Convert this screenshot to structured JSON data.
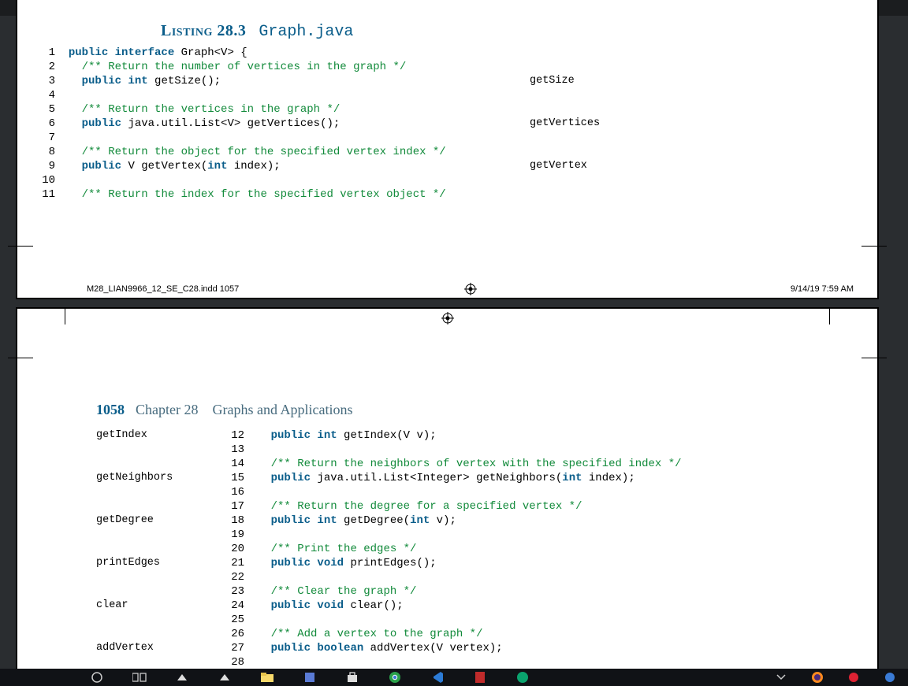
{
  "page1": {
    "listing_label": "Listing 28.3",
    "listing_file": "Graph.java",
    "annotations": [
      "",
      "",
      "getSize",
      "",
      "",
      "getVertices",
      "",
      "",
      "getVertex",
      "",
      ""
    ],
    "footer_left": "M28_LIAN9966_12_SE_C28.indd   1057",
    "footer_right": "9/14/19   7:59 AM",
    "code": [
      {
        "n": "1",
        "seg": [
          {
            "t": "public interface ",
            "c": "kw"
          },
          {
            "t": "Graph<V> {",
            "c": "id"
          }
        ]
      },
      {
        "n": "2",
        "seg": [
          {
            "t": "  ",
            "c": "id"
          },
          {
            "t": "/** Return the number of vertices in the graph */",
            "c": "cm"
          }
        ]
      },
      {
        "n": "3",
        "seg": [
          {
            "t": "  ",
            "c": "id"
          },
          {
            "t": "public int ",
            "c": "kw"
          },
          {
            "t": "getSize();",
            "c": "id"
          }
        ]
      },
      {
        "n": "4",
        "seg": []
      },
      {
        "n": "5",
        "seg": [
          {
            "t": "  ",
            "c": "id"
          },
          {
            "t": "/** Return the vertices in the graph */",
            "c": "cm"
          }
        ]
      },
      {
        "n": "6",
        "seg": [
          {
            "t": "  ",
            "c": "id"
          },
          {
            "t": "public ",
            "c": "kw"
          },
          {
            "t": "java.util.List<V> getVertices();",
            "c": "id"
          }
        ]
      },
      {
        "n": "7",
        "seg": []
      },
      {
        "n": "8",
        "seg": [
          {
            "t": "  ",
            "c": "id"
          },
          {
            "t": "/** Return the object for the specified vertex index */",
            "c": "cm"
          }
        ]
      },
      {
        "n": "9",
        "seg": [
          {
            "t": "  ",
            "c": "id"
          },
          {
            "t": "public ",
            "c": "kw"
          },
          {
            "t": "V getVertex(",
            "c": "id"
          },
          {
            "t": "int ",
            "c": "kw"
          },
          {
            "t": "index);",
            "c": "id"
          }
        ]
      },
      {
        "n": "10",
        "seg": []
      },
      {
        "n": "11",
        "seg": [
          {
            "t": "  ",
            "c": "id"
          },
          {
            "t": "/** Return the index for the specified vertex object */",
            "c": "cm"
          }
        ]
      }
    ]
  },
  "page2": {
    "page_num": "1058",
    "chapter": "Chapter 28",
    "chapter_title": "Graphs and Applications",
    "margin_notes": [
      "getIndex",
      "",
      "",
      "getNeighbors",
      "",
      "",
      "getDegree",
      "",
      "",
      "printEdges",
      "",
      "",
      "clear",
      "",
      "",
      "addVertex",
      "",
      ""
    ],
    "code": [
      {
        "n": "12",
        "seg": [
          {
            "t": "  ",
            "c": "id"
          },
          {
            "t": "public int ",
            "c": "kw"
          },
          {
            "t": "getIndex(V v);",
            "c": "id"
          }
        ]
      },
      {
        "n": "13",
        "seg": []
      },
      {
        "n": "14",
        "seg": [
          {
            "t": "  ",
            "c": "id"
          },
          {
            "t": "/** Return the neighbors of vertex with the specified index */",
            "c": "cm"
          }
        ]
      },
      {
        "n": "15",
        "seg": [
          {
            "t": "  ",
            "c": "id"
          },
          {
            "t": "public ",
            "c": "kw"
          },
          {
            "t": "java.util.List<Integer> getNeighbors(",
            "c": "id"
          },
          {
            "t": "int ",
            "c": "kw"
          },
          {
            "t": "index);",
            "c": "id"
          }
        ]
      },
      {
        "n": "16",
        "seg": []
      },
      {
        "n": "17",
        "seg": [
          {
            "t": "  ",
            "c": "id"
          },
          {
            "t": "/** Return the degree for a specified vertex */",
            "c": "cm"
          }
        ]
      },
      {
        "n": "18",
        "seg": [
          {
            "t": "  ",
            "c": "id"
          },
          {
            "t": "public int ",
            "c": "kw"
          },
          {
            "t": "getDegree(",
            "c": "id"
          },
          {
            "t": "int ",
            "c": "kw"
          },
          {
            "t": "v);",
            "c": "id"
          }
        ]
      },
      {
        "n": "19",
        "seg": []
      },
      {
        "n": "20",
        "seg": [
          {
            "t": "  ",
            "c": "id"
          },
          {
            "t": "/** Print the edges */",
            "c": "cm"
          }
        ]
      },
      {
        "n": "21",
        "seg": [
          {
            "t": "  ",
            "c": "id"
          },
          {
            "t": "public void ",
            "c": "kw"
          },
          {
            "t": "printEdges();",
            "c": "id"
          }
        ]
      },
      {
        "n": "22",
        "seg": []
      },
      {
        "n": "23",
        "seg": [
          {
            "t": "  ",
            "c": "id"
          },
          {
            "t": "/** Clear the graph */",
            "c": "cm"
          }
        ]
      },
      {
        "n": "24",
        "seg": [
          {
            "t": "  ",
            "c": "id"
          },
          {
            "t": "public void ",
            "c": "kw"
          },
          {
            "t": "clear();",
            "c": "id"
          }
        ]
      },
      {
        "n": "25",
        "seg": []
      },
      {
        "n": "26",
        "seg": [
          {
            "t": "  ",
            "c": "id"
          },
          {
            "t": "/** Add a vertex to the graph */",
            "c": "cm"
          }
        ]
      },
      {
        "n": "27",
        "seg": [
          {
            "t": "  ",
            "c": "id"
          },
          {
            "t": "public boolean ",
            "c": "kw"
          },
          {
            "t": "addVertex(V vertex);",
            "c": "id"
          }
        ]
      },
      {
        "n": "28",
        "seg": []
      }
    ]
  }
}
